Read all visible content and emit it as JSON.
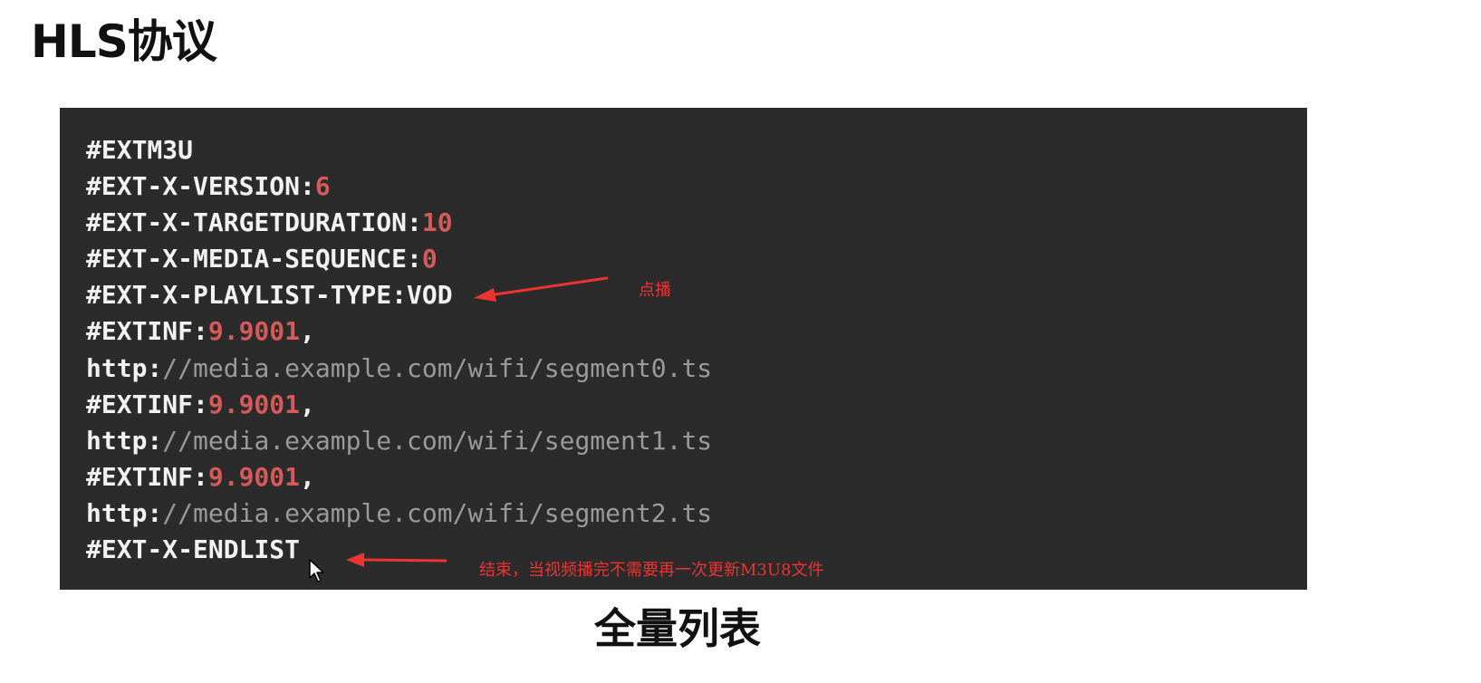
{
  "slide": {
    "title": "HLS协议",
    "subtitle": "全量列表"
  },
  "playlist": {
    "lines": [
      {
        "key": "#EXTM3U",
        "value": "",
        "suffix": ""
      },
      {
        "key": "#EXT-X-VERSION:",
        "value": "6",
        "suffix": ""
      },
      {
        "key": "#EXT-X-TARGETDURATION:",
        "value": "10",
        "suffix": ""
      },
      {
        "key": "#EXT-X-MEDIA-SEQUENCE:",
        "value": "0",
        "suffix": ""
      },
      {
        "key": "#EXT-X-PLAYLIST-TYPE:VOD",
        "value": "",
        "suffix": ""
      },
      {
        "key": "#EXTINF:",
        "value": "9.9001",
        "suffix": ","
      },
      {
        "key": "http:",
        "url": "//media.example.com/wifi/segment0.ts"
      },
      {
        "key": "#EXTINF:",
        "value": "9.9001",
        "suffix": ","
      },
      {
        "key": "http:",
        "url": "//media.example.com/wifi/segment1.ts"
      },
      {
        "key": "#EXTINF:",
        "value": "9.9001",
        "suffix": ","
      },
      {
        "key": "http:",
        "url": "//media.example.com/wifi/segment2.ts"
      },
      {
        "key": "#EXT-X-ENDLIST",
        "value": "",
        "suffix": ""
      }
    ]
  },
  "annotations": {
    "vod_note": "点播",
    "endlist_note": "结束，当视频播完不需要再一次更新M3U8文件"
  },
  "colors": {
    "panel_bg": "#2b2b2b",
    "code_text": "#f2f2f2",
    "number": "#d55a5a",
    "url": "#9a9a9a",
    "annotation": "#ee3333"
  },
  "icons": {
    "pointer": "mouse-pointer-icon",
    "arrow": "red-arrow-icon"
  }
}
